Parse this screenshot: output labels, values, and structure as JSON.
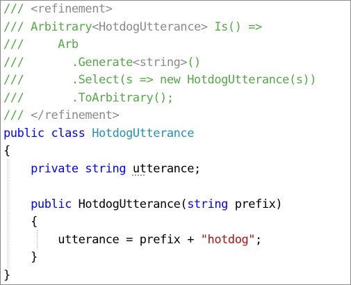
{
  "code": {
    "lines": [
      [
        {
          "c": "c",
          "t": "/// "
        },
        {
          "c": "g",
          "t": "<refinement>"
        }
      ],
      [
        {
          "c": "c",
          "t": "/// Arbitrary"
        },
        {
          "c": "g",
          "t": "<HotdogUtterance>"
        },
        {
          "c": "c",
          "t": " Is() =>"
        }
      ],
      [
        {
          "c": "c",
          "t": "///     Arb"
        }
      ],
      [
        {
          "c": "c",
          "t": "///       .Generate"
        },
        {
          "c": "g",
          "t": "<string>"
        },
        {
          "c": "c",
          "t": "()"
        }
      ],
      [
        {
          "c": "c",
          "t": "///       .Select(s => new HotdogUtterance(s))"
        }
      ],
      [
        {
          "c": "c",
          "t": "///       .ToArbitrary();"
        }
      ],
      [
        {
          "c": "c",
          "t": "/// "
        },
        {
          "c": "g",
          "t": "</refinement>"
        }
      ],
      [
        {
          "c": "k",
          "t": "public class "
        },
        {
          "c": "t",
          "t": "HotdogUtterance"
        }
      ],
      [
        {
          "c": "p",
          "t": "{"
        }
      ],
      [
        {
          "c": "p",
          "t": "    "
        },
        {
          "c": "k",
          "t": "private string "
        },
        {
          "c": "p squig",
          "t": "ut"
        },
        {
          "c": "p",
          "t": "terance;"
        }
      ],
      [
        {
          "c": "p",
          "t": ""
        }
      ],
      [
        {
          "c": "p",
          "t": "    "
        },
        {
          "c": "k",
          "t": "public "
        },
        {
          "c": "p",
          "t": "HotdogUtterance("
        },
        {
          "c": "k",
          "t": "string"
        },
        {
          "c": "p",
          "t": " prefix)"
        }
      ],
      [
        {
          "c": "p",
          "t": "    {"
        }
      ],
      [
        {
          "c": "p",
          "t": "        utterance = prefix + "
        },
        {
          "c": "s",
          "t": "\"hotdog\""
        },
        {
          "c": "p",
          "t": ";"
        }
      ],
      [
        {
          "c": "p",
          "t": "    }"
        }
      ],
      [
        {
          "c": "p",
          "t": "}"
        }
      ]
    ]
  }
}
